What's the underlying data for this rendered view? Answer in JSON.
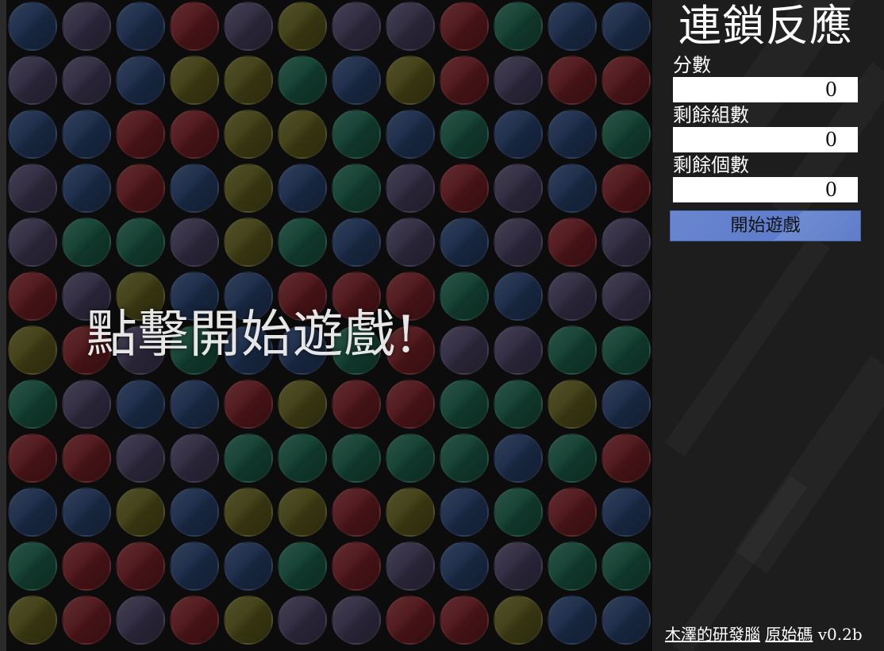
{
  "colors": {
    "red": "#4e1519",
    "blue": "#1a2b48",
    "green": "#123f31",
    "yellow": "#3f3d13",
    "purple": "#2f2a3f",
    "board_bg": "#0c0c0c",
    "button": "#6580cc"
  },
  "board": {
    "rows": [
      [
        "blue",
        "purple",
        "blue",
        "red",
        "purple",
        "yellow",
        "purple",
        "purple",
        "red",
        "green",
        "blue",
        "blue"
      ],
      [
        "purple",
        "purple",
        "blue",
        "yellow",
        "yellow",
        "green",
        "blue",
        "yellow",
        "red",
        "purple",
        "red",
        "red"
      ],
      [
        "blue",
        "blue",
        "red",
        "red",
        "yellow",
        "yellow",
        "green",
        "blue",
        "green",
        "blue",
        "blue",
        "green"
      ],
      [
        "purple",
        "blue",
        "red",
        "blue",
        "yellow",
        "blue",
        "green",
        "purple",
        "red",
        "purple",
        "blue",
        "red"
      ],
      [
        "purple",
        "green",
        "green",
        "purple",
        "yellow",
        "green",
        "blue",
        "purple",
        "blue",
        "purple",
        "red",
        "purple"
      ],
      [
        "red",
        "purple",
        "yellow",
        "blue",
        "blue",
        "red",
        "red",
        "red",
        "green",
        "blue",
        "purple",
        "purple"
      ],
      [
        "yellow",
        "red",
        "purple",
        "green",
        "blue",
        "blue",
        "green",
        "red",
        "purple",
        "purple",
        "green",
        "green"
      ],
      [
        "green",
        "purple",
        "blue",
        "blue",
        "red",
        "yellow",
        "red",
        "red",
        "green",
        "green",
        "yellow",
        "blue"
      ],
      [
        "red",
        "red",
        "purple",
        "purple",
        "green",
        "green",
        "green",
        "green",
        "green",
        "blue",
        "green",
        "red"
      ],
      [
        "blue",
        "blue",
        "yellow",
        "blue",
        "yellow",
        "yellow",
        "red",
        "yellow",
        "blue",
        "green",
        "red",
        "blue"
      ],
      [
        "green",
        "red",
        "red",
        "blue",
        "blue",
        "green",
        "red",
        "purple",
        "blue",
        "purple",
        "green",
        "green"
      ],
      [
        "yellow",
        "red",
        "purple",
        "red",
        "yellow",
        "purple",
        "purple",
        "red",
        "red",
        "yellow",
        "blue",
        "blue"
      ]
    ],
    "overlay_text": "點擊開始遊戲!"
  },
  "sidebar": {
    "title": "連鎖反應",
    "score_label": "分數",
    "score_value": "0",
    "groups_label": "剩餘組數",
    "groups_value": "0",
    "count_label": "剩餘個數",
    "count_value": "0",
    "start_button": "開始遊戲"
  },
  "footer": {
    "link1": "木澤的研發腦",
    "link2": "原始碼",
    "version": "v0.2b"
  }
}
